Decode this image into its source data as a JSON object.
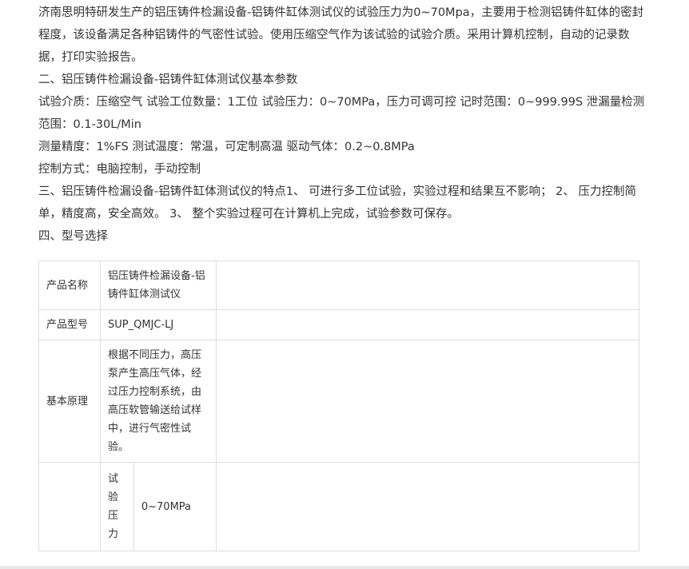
{
  "article": {
    "paragraphs": [
      "济南思明特研发生产的铝压铸件检漏设备-铝铸件缸体测试仪的试验压力为0~70Mpa，主要用于检测铝铸件缸体的密封程度，该设备满足各种铝铸件的气密性试验。使用压缩空气作为该试验的试验介质。采用计算机控制，自动的记录数据，打印实验报告。",
      "二、铝压铸件检漏设备-铝铸件缸体测试仪基本参数",
      "试验介质：压缩空气 试验工位数量：1工位 试验压力：0~70MPa，压力可调可控 记时范围：0~999.99S 泄漏量检测范围：0.1-30L/Min",
      "测量精度：1%FS 测试温度：常温，可定制高温 驱动气体：0.2~0.8MPa",
      "控制方式：电脑控制，手动控制",
      "三、铝压铸件检漏设备-铝铸件缸体测试仪的特点1、 可进行多工位试验，实验过程和结果互不影响； 2、 压力控制简单，精度高，安全高效。 3、 整个实验过程可在计算机上完成，试验参数可保存。",
      "四、型号选择"
    ]
  },
  "spec_table": {
    "rows": [
      {
        "key": "产品名称",
        "value": "铝压铸件检漏设备-铝铸件缸体测试仪"
      },
      {
        "key": "产品型号",
        "value": "SUP_QMJC-LJ"
      },
      {
        "key": "基本原理",
        "value": "根据不同压力，高压泵产生高压气体，经过压力控制系统，由高压软管输送给试样中，进行气密性试验。"
      }
    ],
    "params_row": {
      "sub_key": "试验压力",
      "sub_value": "0~70MPa"
    }
  }
}
